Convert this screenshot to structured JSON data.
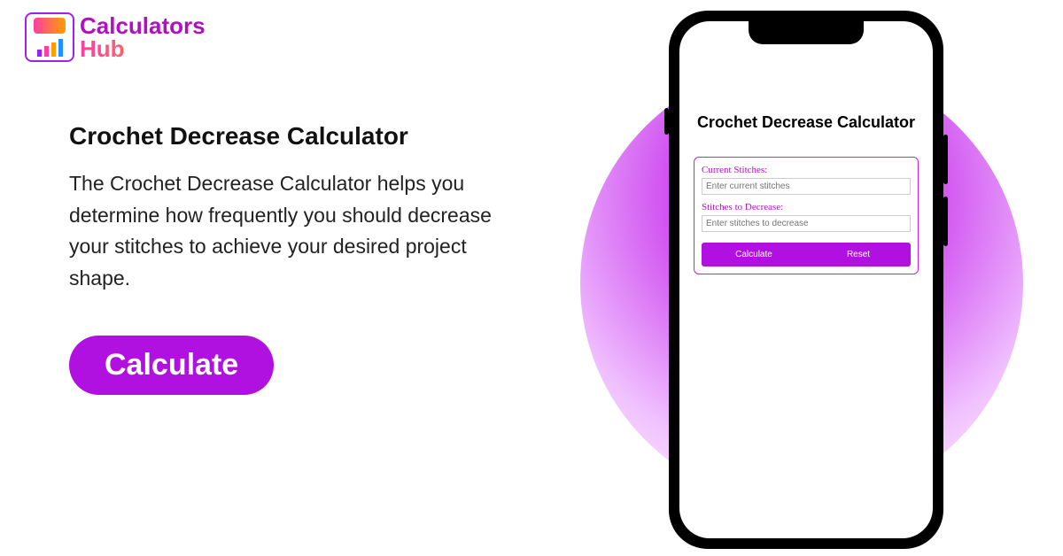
{
  "logo": {
    "line1": "Calculators",
    "line2": "Hub"
  },
  "page": {
    "title": "Crochet Decrease Calculator",
    "description": "The Crochet Decrease Calculator helps you determine how frequently you should decrease your stitches to achieve your desired project shape.",
    "cta_label": "Calculate"
  },
  "phone": {
    "title": "Crochet Decrease Calculator",
    "form": {
      "field1_label": "Current Stitches:",
      "field1_placeholder": "Enter current stitches",
      "field2_label": "Stitches to Decrease:",
      "field2_placeholder": "Enter stitches to decrease",
      "calculate_label": "Calculate",
      "reset_label": "Reset"
    }
  },
  "colors": {
    "brand_purple": "#b010e0",
    "brand_magenta": "#ff3ea5",
    "brand_orange": "#ff9e00"
  }
}
